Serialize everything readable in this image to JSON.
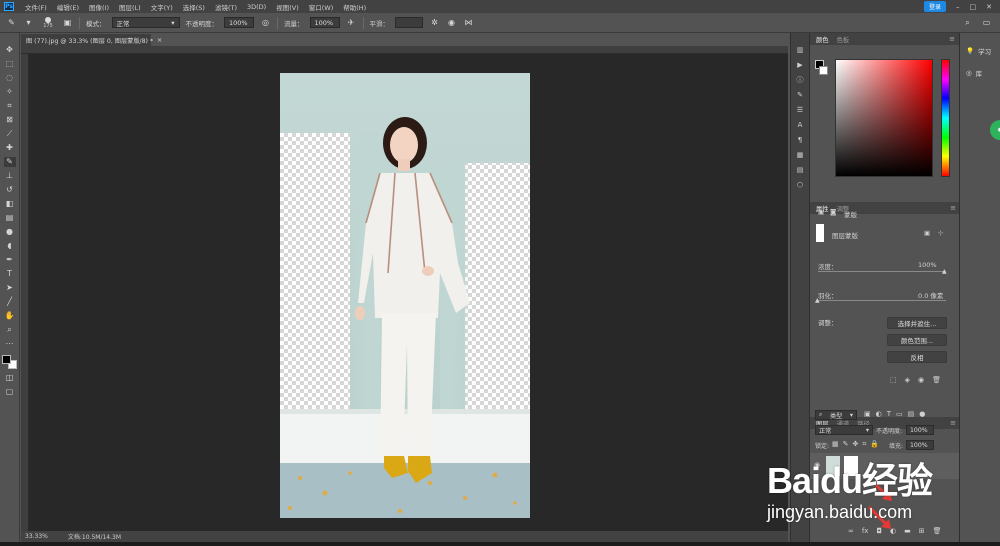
{
  "menubar": {
    "logo": "Ps",
    "items": [
      "文件(F)",
      "编辑(E)",
      "图像(I)",
      "图层(L)",
      "文字(Y)",
      "选择(S)",
      "滤镜(T)",
      "3D(D)",
      "视图(V)",
      "窗口(W)",
      "帮助(H)"
    ],
    "cloud_badge": "登录"
  },
  "options": {
    "brush_size": "175",
    "mode_label": "模式：",
    "mode_value": "正常",
    "opacity_label": "不透明度：",
    "opacity_value": "100%",
    "flow_label": "流量：",
    "flow_value": "100%",
    "smoothing_label": "平滑："
  },
  "document": {
    "tab_title": "图 (77).jpg @ 33.3% (图层 0, 图层蒙版/8) *",
    "zoom": "33.33%",
    "doc_size": "文档:10.5M/14.3M"
  },
  "color_panel": {
    "tabs": [
      "颜色",
      "色板"
    ],
    "fg_color": "#000000",
    "bg_color": "#ffffff"
  },
  "properties_panel": {
    "tabs": [
      "属性",
      "调整"
    ],
    "mask_type": "蒙版",
    "layer_mask_label": "图层蒙版",
    "density_label": "浓度：",
    "density_value": "100%",
    "feather_label": "羽化：",
    "feather_value": "0.0 像素",
    "adjust_label": "调整：",
    "buttons": [
      "选择并遮住...",
      "颜色范围...",
      "反相"
    ]
  },
  "layers_panel": {
    "tabs": [
      "图层",
      "通道",
      "路径"
    ],
    "filter_kind": "类型",
    "blend_mode": "正常",
    "opacity_label": "不透明度:",
    "opacity_value": "100%",
    "lock_label": "锁定:",
    "fill_label": "填充:",
    "fill_value": "100%"
  },
  "learn_panel": {
    "items": [
      "学习",
      "库"
    ]
  },
  "watermark": {
    "brand": "Baidu经验",
    "url": "jingyan.baidu.com"
  },
  "colors": {
    "accent": "#1e88e5",
    "ui_dark": "#424242",
    "ui_mid": "#535353",
    "canvas": "#282828",
    "wall": "#bcd3cf",
    "arrow": "#e53935"
  }
}
